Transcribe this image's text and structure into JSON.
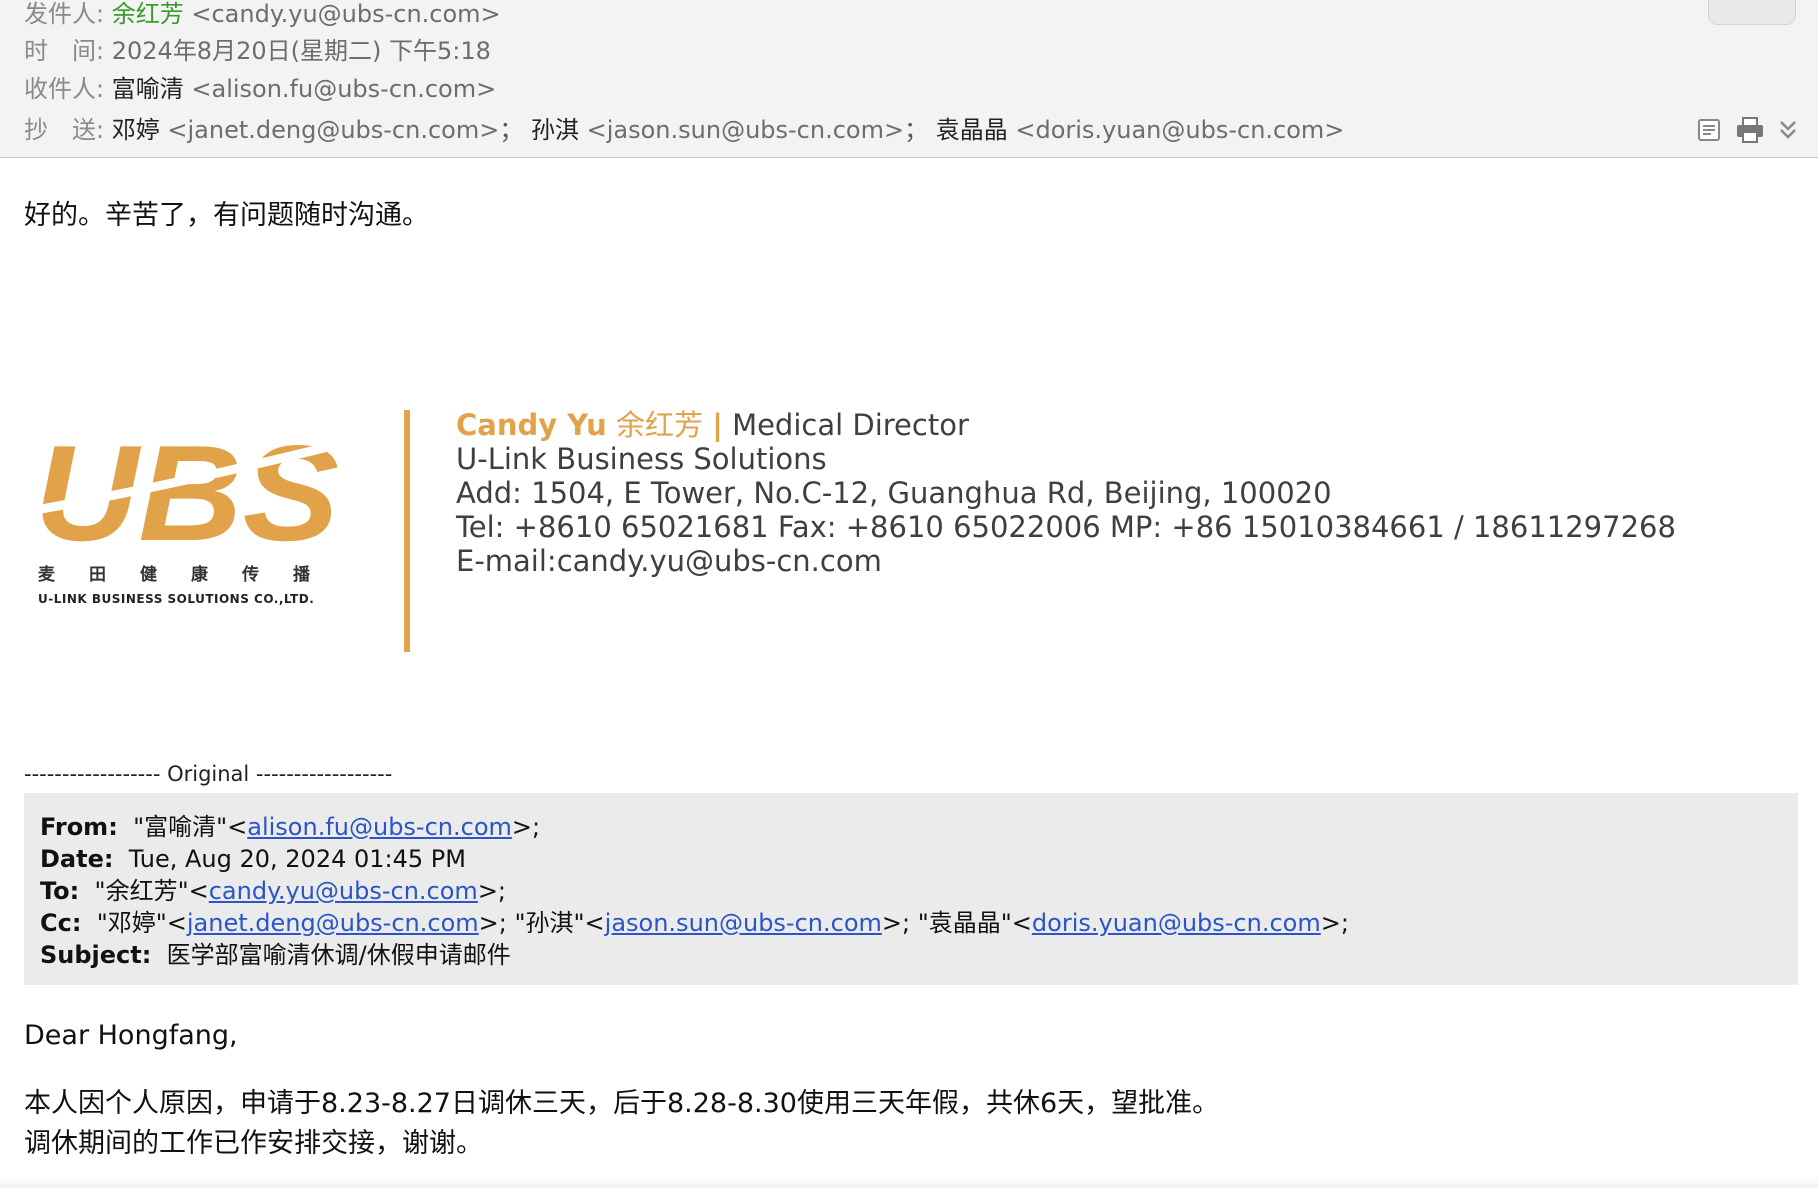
{
  "header": {
    "from_label": "发件人:",
    "from_name": "余红芳",
    "from_email": "<candy.yu@ubs-cn.com>",
    "time_label": "时　间:",
    "time_value": "2024年8月20日(星期二) 下午5:18",
    "to_label": "收件人:",
    "to_name": "富喻清",
    "to_email": "<alison.fu@ubs-cn.com>",
    "cc_label": "抄　送:",
    "cc": [
      {
        "name": "邓婷",
        "email": "<janet.deng@ubs-cn.com>"
      },
      {
        "name": "孙淇",
        "email": "<jason.sun@ubs-cn.com>"
      },
      {
        "name": "袁晶晶",
        "email": "<doris.yuan@ubs-cn.com>"
      }
    ],
    "cc_separator": "；",
    "icons": [
      "note-icon",
      "print-icon",
      "expand-chevron-icon"
    ]
  },
  "reply": "好的。辛苦了，有问题随时沟通。",
  "signature": {
    "logo_text": "UBS",
    "logo_cn": "麦田健康传播",
    "logo_en": "U-LINK BUSINESS SOLUTIONS CO.,LTD.",
    "name_en": "Candy Yu",
    "name_cn": "余红芳",
    "divider": "|",
    "title": "Medical Director",
    "company": "U-Link Business Solutions",
    "address": "Add: 1504, E Tower, No.C-12, Guanghua Rd, Beijing, 100020",
    "phones": "Tel: +8610 65021681  Fax: +8610 65022006  MP: +86 15010384661 / 18611297268",
    "email": "E-mail:candy.yu@ubs-cn.com",
    "accent": "#e2a24a"
  },
  "original": {
    "separator": "------------------ Original ------------------",
    "from_label": "From:",
    "from_name": "\"富喻清\"<",
    "from_link": "alison.fu@ubs-cn.com",
    "from_end": ">;",
    "date_label": "Date:",
    "date_value": "Tue, Aug 20, 2024 01:45 PM",
    "to_label": "To:",
    "to_name": "\"余红芳\"<",
    "to_link": "candy.yu@ubs-cn.com",
    "to_end": ">;",
    "cc_label": "Cc:",
    "cc": [
      {
        "pre": "\"邓婷\"<",
        "link": "janet.deng@ubs-cn.com",
        "post": ">; "
      },
      {
        "pre": "\"孙淇\"<",
        "link": "jason.sun@ubs-cn.com",
        "post": ">; "
      },
      {
        "pre": "\"袁晶晶\"<",
        "link": "doris.yuan@ubs-cn.com",
        "post": ">;"
      }
    ],
    "subject_label": "Subject:",
    "subject_value": "医学部富喻清休调/休假申请邮件"
  },
  "body": {
    "greeting": "Dear Hongfang,",
    "line1": "本人因个人原因，申请于8.23-8.27日调休三天，后于8.28-8.30使用三天年假，共休6天，望批准。",
    "line2": "调休期间的工作已作安排交接，谢谢。"
  }
}
